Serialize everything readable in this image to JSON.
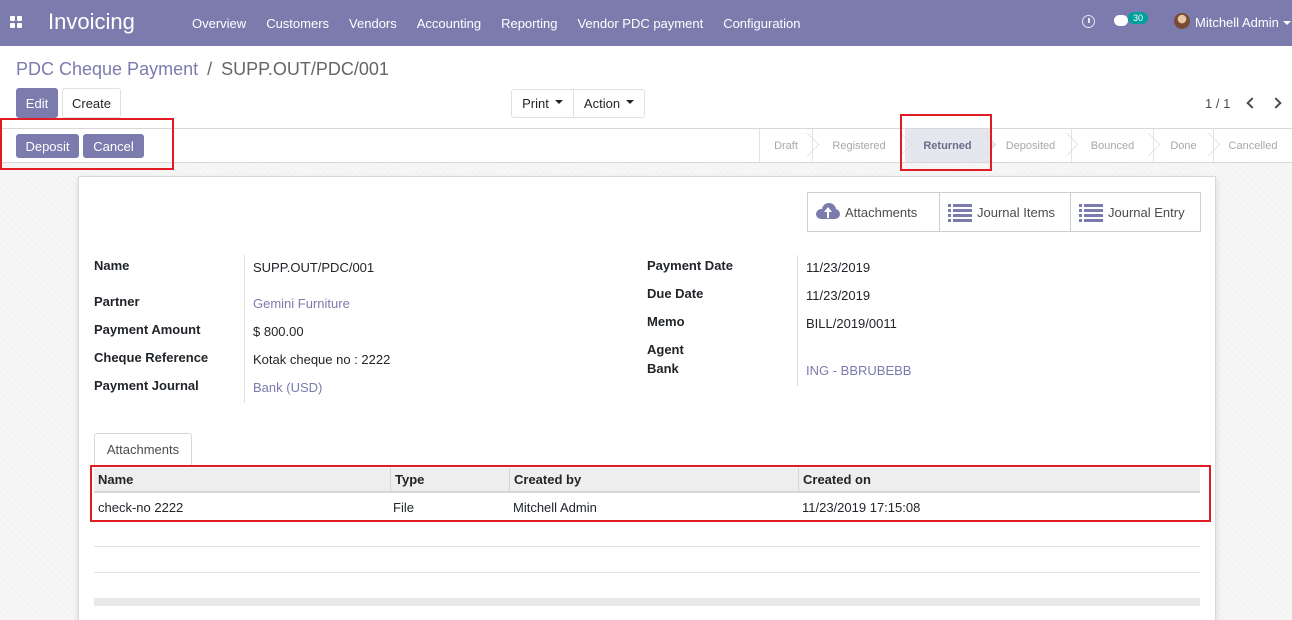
{
  "navbar": {
    "app_title": "Invoicing",
    "menu": [
      "Overview",
      "Customers",
      "Vendors",
      "Accounting",
      "Reporting",
      "Vendor PDC payment",
      "Configuration"
    ],
    "chat_count": "30",
    "user_name": "Mitchell Admin",
    "bg_color": "#7c7bad"
  },
  "breadcrumb": {
    "parent": "PDC Cheque Payment",
    "separator": "/",
    "current": "SUPP.OUT/PDC/001"
  },
  "control": {
    "edit_label": "Edit",
    "create_label": "Create",
    "print_label": "Print",
    "action_label": "Action",
    "pager_value": "1 / 1"
  },
  "statusbar": {
    "deposit_label": "Deposit",
    "cancel_label": "Cancel",
    "steps": [
      "Draft",
      "Registered",
      "Returned",
      "Deposited",
      "Bounced",
      "Done",
      "Cancelled"
    ],
    "active_step": "Returned"
  },
  "smart_buttons": {
    "attachments_label": "Attachments",
    "journal_items_label": "Journal Items",
    "journal_entry_label": "Journal Entry"
  },
  "fields_left": {
    "name_label": "Name",
    "name_value": "SUPP.OUT/PDC/001",
    "partner_label": "Partner",
    "partner_value": "Gemini Furniture",
    "amount_label": "Payment Amount",
    "amount_value": "$ 800.00",
    "cheque_label": "Cheque Reference",
    "cheque_value": "Kotak cheque no : 2222",
    "journal_label": "Payment Journal",
    "journal_value": "Bank (USD)"
  },
  "fields_right": {
    "payment_date_label": "Payment Date",
    "payment_date_value": "11/23/2019",
    "due_date_label": "Due Date",
    "due_date_value": "11/23/2019",
    "memo_label": "Memo",
    "memo_value": "BILL/2019/0011",
    "agent_bank_label_1": "Agent",
    "agent_bank_label_2": "Bank",
    "agent_bank_value": "ING - BBRUBEBB"
  },
  "notebook": {
    "tab_label": "Attachments",
    "columns": [
      "Name",
      "Type",
      "Created by",
      "Created on"
    ],
    "rows": [
      [
        "check-no 2222",
        "File",
        "Mitchell Admin",
        "11/23/2019 17:15:08"
      ]
    ]
  },
  "colors": {
    "accent": "#7c7bad",
    "highlight": "#e01c24",
    "badge": "#00a09d"
  }
}
